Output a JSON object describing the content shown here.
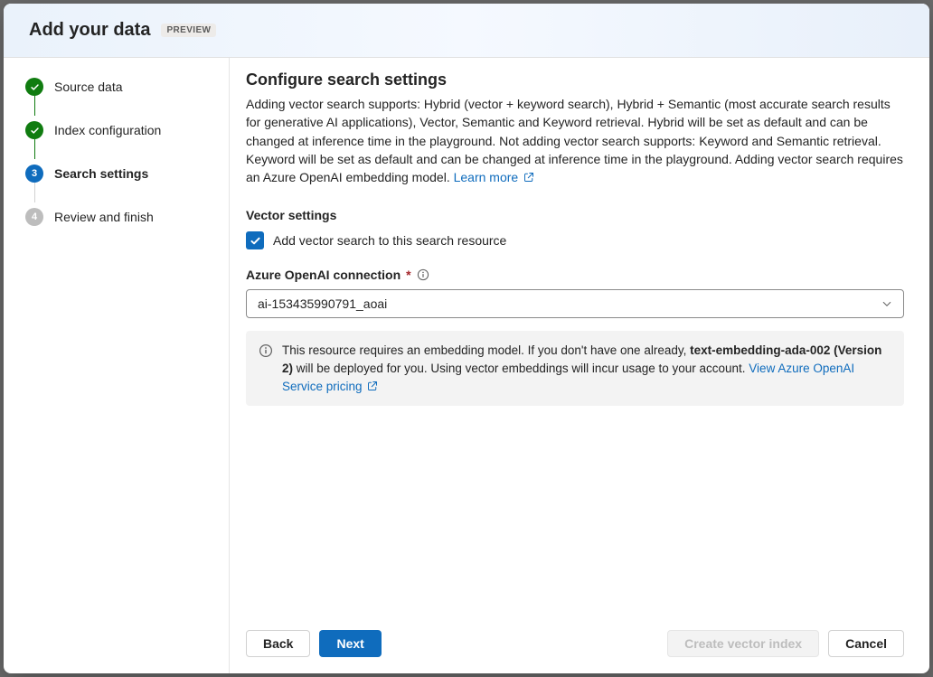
{
  "header": {
    "title": "Add your data",
    "badge": "PREVIEW"
  },
  "steps": [
    {
      "label": "Source data",
      "state": "done"
    },
    {
      "label": "Index configuration",
      "state": "done"
    },
    {
      "label": "Search settings",
      "state": "current",
      "number": "3"
    },
    {
      "label": "Review and finish",
      "state": "pending",
      "number": "4"
    }
  ],
  "content": {
    "heading": "Configure search settings",
    "description": "Adding vector search supports: Hybrid (vector + keyword search), Hybrid + Semantic (most accurate search results for generative AI applications), Vector, Semantic and Keyword retrieval. Hybrid will be set as default and can be changed at inference time in the playground. Not adding vector search supports: Keyword and Semantic retrieval. Keyword will be set as default and can be changed at inference time in the playground. Adding vector search requires an Azure OpenAI embedding model.",
    "learn_more": "Learn more",
    "vector_settings_label": "Vector settings",
    "vector_checkbox_label": "Add vector search to this search resource",
    "connection_label": "Azure OpenAI connection",
    "connection_value": "ai-153435990791_aoai",
    "info_pre": "This resource requires an embedding model. If you don't have one already, ",
    "info_bold": "text-embedding-ada-002 (Version 2)",
    "info_post": " will be deployed for you. Using vector embeddings will incur usage to your account.",
    "info_link": "View Azure OpenAI Service pricing"
  },
  "footer": {
    "back": "Back",
    "next": "Next",
    "create": "Create vector index",
    "cancel": "Cancel"
  }
}
